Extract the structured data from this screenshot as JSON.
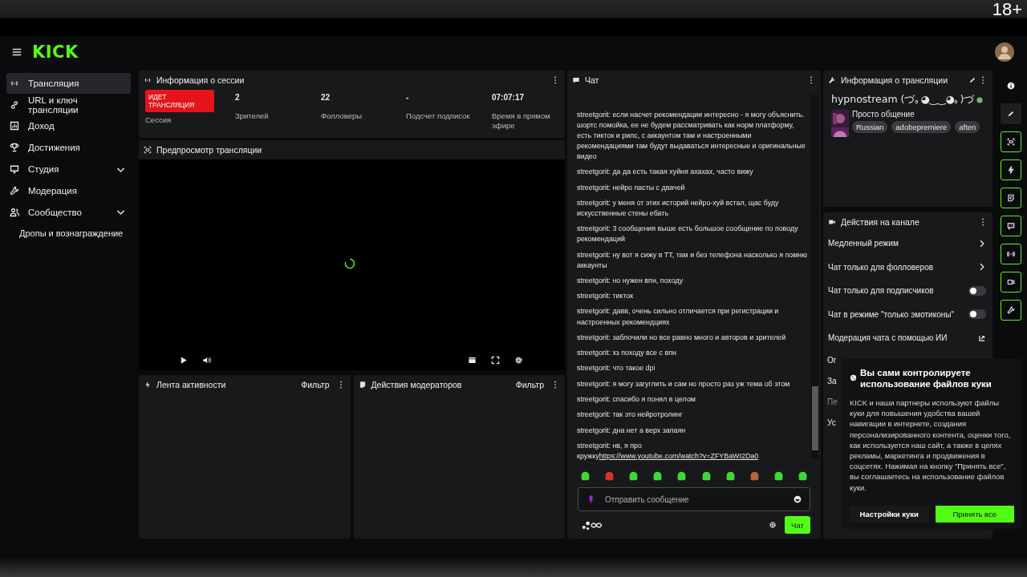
{
  "top_strip": {
    "age_rating": "18+"
  },
  "header": {
    "logo": "KICK"
  },
  "sidebar": {
    "items": [
      {
        "label": "Трансляция",
        "selected": true,
        "expandable": false
      },
      {
        "label": "URL и ключ трансляции",
        "selected": false,
        "expandable": false
      },
      {
        "label": "Доход",
        "selected": false,
        "expandable": false
      },
      {
        "label": "Достижения",
        "selected": false,
        "expandable": false
      },
      {
        "label": "Студия",
        "selected": false,
        "expandable": true
      },
      {
        "label": "Модерация",
        "selected": false,
        "expandable": false
      },
      {
        "label": "Сообщество",
        "selected": false,
        "expandable": true,
        "children": [
          {
            "label": "Дропы и вознаграждение",
            "selected": false
          }
        ]
      }
    ]
  },
  "session": {
    "title": "Информация о сессии",
    "live_badge": "ИДЕТ ТРАНСЛЯЦИЯ",
    "badge_caption": "Сессия",
    "stats": [
      {
        "value": "2",
        "label": "Зрителей"
      },
      {
        "value": "22",
        "label": "Фолловеры"
      },
      {
        "value": "-",
        "label": "Подсчет подписок"
      },
      {
        "value": "07:07:17",
        "label": "Время в прямом эфире"
      }
    ]
  },
  "preview": {
    "title": "Предпросмотр трансляции"
  },
  "activity": {
    "title": "Лента активности",
    "filter": "Фильтр"
  },
  "mod_actions": {
    "title": "Действия модераторов",
    "filter": "Фильтр"
  },
  "chat": {
    "title": "Чат",
    "messages": [
      {
        "user": "streetgorit:",
        "text": "если насчет рекомендации интересно - я могу объяснить. шортс помойка, ее не будем рассматривать как норм платформу, есть тикток и рилс, с аккаунтом там и настроенными рекомендациями там будут выдаваться интересные и оригинальные видео"
      },
      {
        "user": "streetgorit:",
        "text": "да да есть такая хуйня ахахах, часто вижу"
      },
      {
        "user": "streetgorit:",
        "text": "нейро пасты с двачей"
      },
      {
        "user": "streetgorit:",
        "text": "у меня от этих историй нейро-хуй встал, щас буду искусственные стены ебать"
      },
      {
        "user": "streetgorit:",
        "text": "3 сообщения выше есть большое сообщение по поводу рекомендаций"
      },
      {
        "user": "streetgorit:",
        "text": "ну вот я сижу в ТТ, там и без телефона насколько я помню аккаунты"
      },
      {
        "user": "streetgorit:",
        "text": "но нужен впн, походу"
      },
      {
        "user": "streetgorit:",
        "text": "тикток"
      },
      {
        "user": "streetgorit:",
        "text": "давв, очень сильно отличается при регистрации и настроенных рекомендциях"
      },
      {
        "user": "streetgorit:",
        "text": "заблочили но все равно много и авторов и зрителей"
      },
      {
        "user": "streetgorit:",
        "text": "хз походу все с впн"
      },
      {
        "user": "streetgorit:",
        "text": "что такое dpi"
      },
      {
        "user": "streetgorit:",
        "text": "я могу загуглить и сам но просто раз уж тема об этом"
      },
      {
        "user": "streetgorit:",
        "text": "спасибо я понял в целом"
      },
      {
        "user": "streetgorit:",
        "text": "так это нейротролинг"
      },
      {
        "user": "streetgorit:",
        "text": "дна нет а верх запаян"
      },
      {
        "user": "streetgorit:",
        "text": "нв, я про кружку",
        "link": "https://www.youtube.com/watch?v=ZFYBaWI2Da0"
      }
    ],
    "emotes": [
      {
        "color": "#3fd83a"
      },
      {
        "color": "#d8312c"
      },
      {
        "color": "#3fd83a"
      },
      {
        "color": "#3fd83a"
      },
      {
        "color": "#3fd83a"
      },
      {
        "color": "#3fd83a"
      },
      {
        "color": "#3fd83a"
      },
      {
        "color": "#b5653c"
      },
      {
        "color": "#3fd83a"
      },
      {
        "color": "#3fd83a"
      }
    ],
    "placeholder": "Отправить сообщение",
    "send": "Чат"
  },
  "stream_info": {
    "title": "Информация о трансляции",
    "stream_title": "hypnostream (づ｡◕‿‿◕｡)づ",
    "category": "Просто общение",
    "tags": [
      "Russian",
      "adobepremiere",
      "aften"
    ]
  },
  "channel_actions": {
    "title": "Действия на канале",
    "items": [
      {
        "label": "Медленный режим",
        "kind": "submenu",
        "disabled": false
      },
      {
        "label": "Чат только для фолловеров",
        "kind": "submenu",
        "disabled": false
      },
      {
        "label": "Чат только для подписчиков",
        "kind": "toggle",
        "on": false,
        "disabled": false
      },
      {
        "label": "Чат в режиме \"только эмотиконы\"",
        "kind": "toggle",
        "on": false,
        "disabled": false
      },
      {
        "label": "Модерация чата с помощью ИИ",
        "kind": "external",
        "disabled": false
      },
      {
        "label": "Ог",
        "kind": "plain",
        "disabled": false
      },
      {
        "label": "За",
        "kind": "plain",
        "disabled": false
      },
      {
        "label": "Пе",
        "kind": "plain",
        "disabled": true
      },
      {
        "label": "Ус",
        "kind": "plain",
        "disabled": false
      }
    ]
  },
  "cookie": {
    "title": "Вы сами контролируете использование файлов куки",
    "body": "KICK и наши партнеры используют файлы куки для повышения удобства вашей навигации в интернете, создания персонализированного контента, оценки того, как используется наш сайт, а также в целях рекламы, маркетинга и продвижения в соцсетях. Нажимая на кнопку \"Принять все\", вы соглашаетесь на использование файлов куки.",
    "settings_button": "Настройки куки",
    "accept_button": "Принять все"
  }
}
